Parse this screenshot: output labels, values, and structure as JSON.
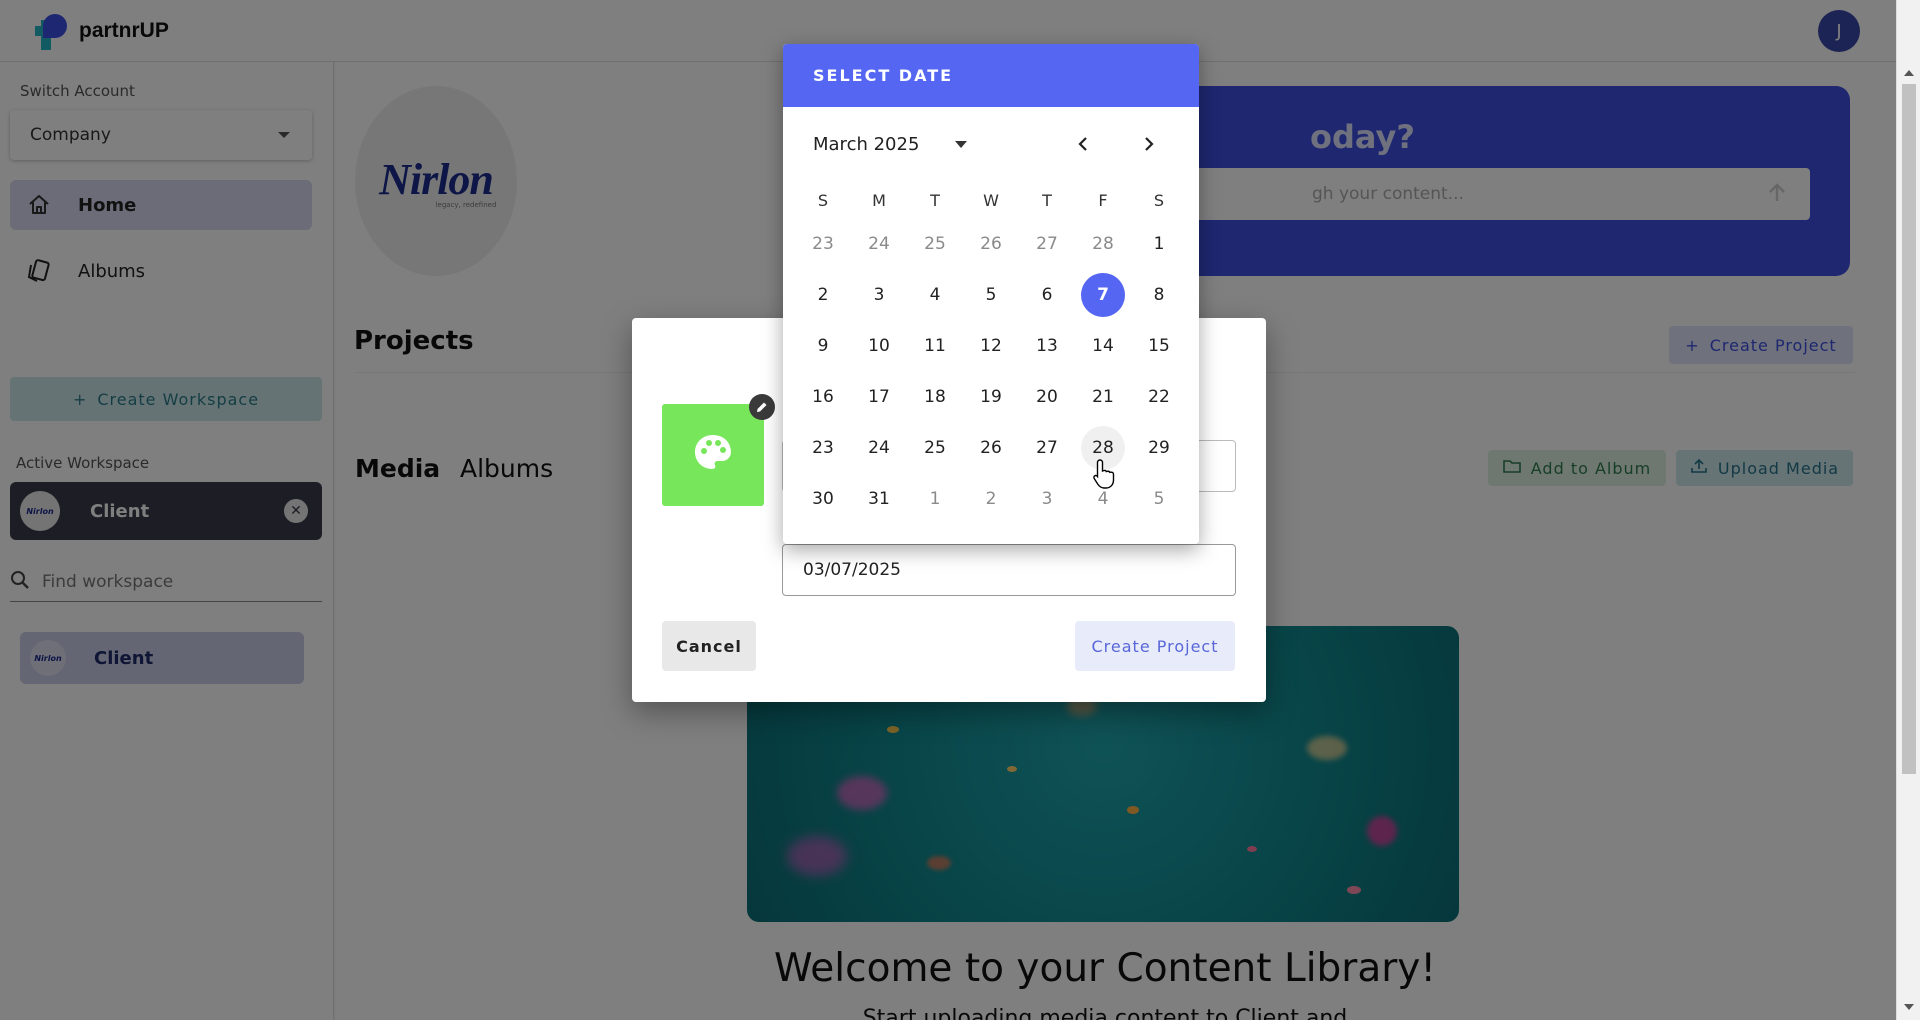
{
  "app": {
    "logo_text": "partnrUP",
    "user_initial": "J"
  },
  "sidebar": {
    "switch_account_label": "Switch Account",
    "account_value": "Company",
    "nav": [
      {
        "label": "Home",
        "icon": "home-icon"
      },
      {
        "label": "Albums",
        "icon": "album-icon"
      }
    ],
    "create_workspace_label": "Create Workspace",
    "active_workspace_label": "Active Workspace",
    "active_workspace": {
      "name": "Client",
      "avatar_text": "Nirlon"
    },
    "find_workspace_placeholder": "Find workspace",
    "workspaces": [
      {
        "name": "Client",
        "avatar_text": "Nirlon"
      }
    ]
  },
  "main": {
    "brand_logo_text": "Nirlon",
    "brand_tagline": "legacy, redefined",
    "hero_title": "oday?",
    "hero_search_placeholder": "gh your content...",
    "projects_title": "Projects",
    "create_project_label": "Create Project",
    "tabs": [
      {
        "label": "Media",
        "active": true
      },
      {
        "label": "Albums",
        "active": false
      }
    ],
    "add_to_album_label": "Add to Album",
    "upload_media_label": "Upload Media",
    "welcome_title": "Welcome to your Content Library!",
    "welcome_sub": "Start uploading media content to Client and"
  },
  "dialog": {
    "project_color": "#78e65a",
    "date_value": "03/07/2025",
    "cancel_label": "Cancel",
    "create_label": "Create Project"
  },
  "date_picker": {
    "header": "SELECT DATE",
    "month_label": "March 2025",
    "weekdays": [
      "S",
      "M",
      "T",
      "W",
      "T",
      "F",
      "S"
    ],
    "weeks": [
      [
        {
          "d": "23",
          "o": true
        },
        {
          "d": "24",
          "o": true
        },
        {
          "d": "25",
          "o": true
        },
        {
          "d": "26",
          "o": true
        },
        {
          "d": "27",
          "o": true
        },
        {
          "d": "28",
          "o": true
        },
        {
          "d": "1"
        }
      ],
      [
        {
          "d": "2"
        },
        {
          "d": "3"
        },
        {
          "d": "4"
        },
        {
          "d": "5"
        },
        {
          "d": "6"
        },
        {
          "d": "7",
          "sel": true
        },
        {
          "d": "8"
        }
      ],
      [
        {
          "d": "9"
        },
        {
          "d": "10"
        },
        {
          "d": "11"
        },
        {
          "d": "12"
        },
        {
          "d": "13"
        },
        {
          "d": "14"
        },
        {
          "d": "15"
        }
      ],
      [
        {
          "d": "16"
        },
        {
          "d": "17"
        },
        {
          "d": "18"
        },
        {
          "d": "19"
        },
        {
          "d": "20"
        },
        {
          "d": "21"
        },
        {
          "d": "22"
        }
      ],
      [
        {
          "d": "23"
        },
        {
          "d": "24"
        },
        {
          "d": "25"
        },
        {
          "d": "26"
        },
        {
          "d": "27"
        },
        {
          "d": "28",
          "hover": true
        },
        {
          "d": "29"
        }
      ],
      [
        {
          "d": "30"
        },
        {
          "d": "31"
        },
        {
          "d": "1",
          "o": true
        },
        {
          "d": "2",
          "o": true
        },
        {
          "d": "3",
          "o": true
        },
        {
          "d": "4",
          "o": true
        },
        {
          "d": "5",
          "o": true
        }
      ]
    ]
  },
  "colors": {
    "primary": "#5566f2",
    "hero_blue": "#3c4fe0",
    "sidebar_active_bg": "#3a3d4a"
  }
}
